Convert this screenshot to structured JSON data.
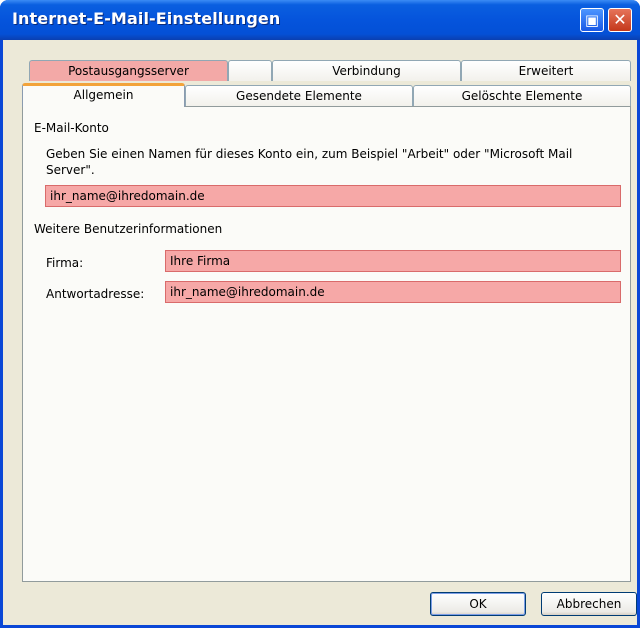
{
  "window": {
    "title": "Internet-E-Mail-Einstellungen"
  },
  "tabs_top": [
    {
      "label": "Postausgangsserver",
      "highlighted": true
    },
    {
      "label": "Verbindung"
    },
    {
      "label": "Erweitert"
    }
  ],
  "tabs_bottom": [
    {
      "label": "Allgemein",
      "active": true
    },
    {
      "label": "Gesendete Elemente"
    },
    {
      "label": "Gelöschte Elemente"
    }
  ],
  "account": {
    "group_label": "E-Mail-Konto",
    "description": "Geben Sie einen Namen für dieses Konto ein, zum Beispiel \"Arbeit\" oder \"Microsoft Mail Server\".",
    "value": "ihr_name@ihredomain.de"
  },
  "user_info": {
    "group_label": "Weitere Benutzerinformationen",
    "company_label": "Firma:",
    "company_value": "Ihre Firma",
    "reply_label": "Antwortadresse:",
    "reply_value": "ihr_name@ihredomain.de"
  },
  "buttons": {
    "ok": "OK",
    "cancel": "Abbrechen"
  },
  "colors": {
    "titlebar": "#0554dc",
    "highlight": "#f6a8a7",
    "dialog_bg": "#ece9d8"
  }
}
